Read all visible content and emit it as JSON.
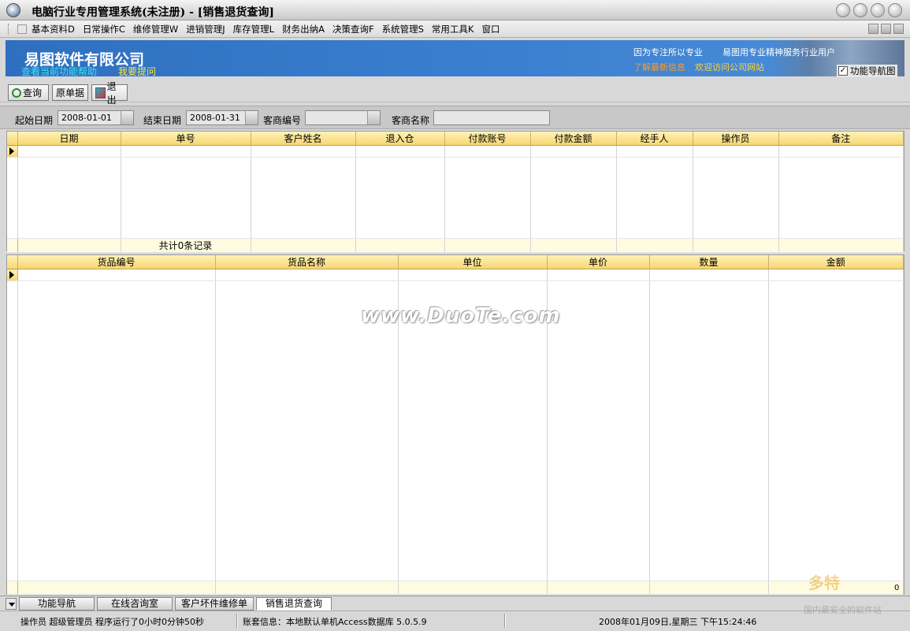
{
  "window": {
    "title": "电脑行业专用管理系统(未注册) - [销售退货查询]"
  },
  "menu": {
    "items": [
      "基本资料D",
      "日常操作C",
      "维修管理W",
      "进销管理J",
      "库存管理L",
      "财务出纳A",
      "决策查询F",
      "系统管理S",
      "常用工具K",
      "窗口"
    ]
  },
  "banner": {
    "company": "易图软件有限公司",
    "help_link": "查看当前功能帮助",
    "ask_link": "我要提问",
    "slogan1": "因为专注所以专业",
    "slogan2": "易图用专业精神服务行业用户",
    "news_link": "了解最新信息",
    "visit_link": "欢迎访问公司网站"
  },
  "nav_toggle": {
    "label": "功能导航图",
    "checked": true,
    "check_mark": "✓"
  },
  "toolbar": {
    "query": "查询",
    "original": "原单据",
    "exit": "退出"
  },
  "filters": {
    "start_label": "起始日期",
    "start_value": "2008-01-01",
    "end_label": "结束日期",
    "end_value": "2008-01-31",
    "customer_code_label": "客商编号",
    "customer_code_value": "",
    "customer_name_label": "客商名称",
    "customer_name_value": ""
  },
  "grid1": {
    "columns": [
      "日期",
      "单号",
      "客户姓名",
      "退入仓",
      "付款账号",
      "付款金额",
      "经手人",
      "操作员",
      "备注"
    ],
    "footer_count": "共计0条记录"
  },
  "grid2": {
    "columns": [
      "货品编号",
      "货品名称",
      "单位",
      "单价",
      "数量",
      "金额"
    ]
  },
  "watermark": "www.DuoTe.com",
  "tabs": [
    "功能导航",
    "在线咨询室",
    "客户坏件维修单",
    "销售退货查询"
  ],
  "tab_counter": "0",
  "status": {
    "operator": "操作员 超级管理员 程序运行了0小时0分钟50秒",
    "account": "账套信息：本地默认单机Access数据库 5.0.5.9",
    "datetime": "2008年01月09日,星期三  下午15:24:46"
  },
  "corner": {
    "logo": "多特",
    "tagline": "国内最安全的软件站"
  }
}
